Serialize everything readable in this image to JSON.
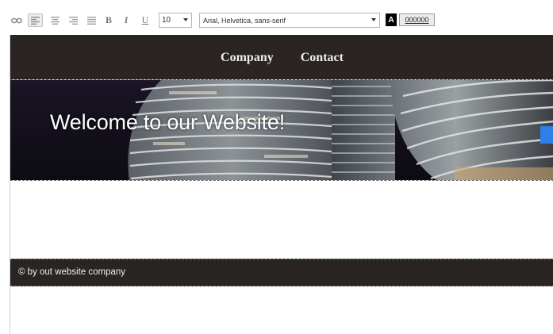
{
  "toolbar": {
    "font_size": "10",
    "font_family": "Arial, Helvetica, sans-serif",
    "bold_label": "B",
    "italic_label": "I",
    "underline_label": "U",
    "color_swatch_label": "A",
    "color_value": "000000",
    "icons": [
      "link-icon",
      "align-left-icon",
      "align-center-icon",
      "align-right-icon",
      "align-justify-icon"
    ]
  },
  "site": {
    "nav": [
      "Company",
      "Contact"
    ],
    "hero_title": "Welcome to our Website!",
    "footer_text": "© by out website company"
  },
  "colors": {
    "nav_bg": "#2a2523",
    "footer_bg": "#2a2523",
    "nav_text": "#f2efe9",
    "hero_text": "#ffffff",
    "color_swatch": "#000000"
  }
}
